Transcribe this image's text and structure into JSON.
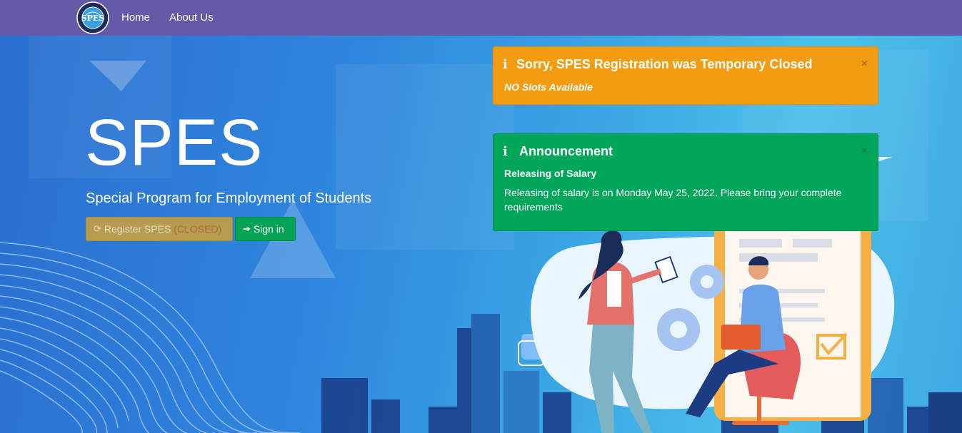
{
  "navbar": {
    "logo_text": "SPES",
    "home_label": "Home",
    "about_label": "About Us"
  },
  "hero": {
    "title": "SPES",
    "subtitle": "Special Program for Employment of Students",
    "register_label": "Register SPES",
    "register_closed": "(CLOSED)",
    "signin_label": "Sign in"
  },
  "alerts": {
    "warning": {
      "icon": "info-icon",
      "title": "Sorry, SPES Registration was Temporary Closed",
      "subtitle": "NO Slots Available",
      "close": "×"
    },
    "announcement": {
      "icon": "info-icon",
      "title": "Announcement",
      "heading": "Releasing of Salary",
      "body": "Releasing of salary is on Monday May 25, 2022. Please bring your complete requirements",
      "close": "×"
    }
  },
  "colors": {
    "navbar": "#635aa8",
    "warning": "#f39c12",
    "success": "#00a65a",
    "register_button": "#b59c4f",
    "signin_button": "#05a356"
  }
}
